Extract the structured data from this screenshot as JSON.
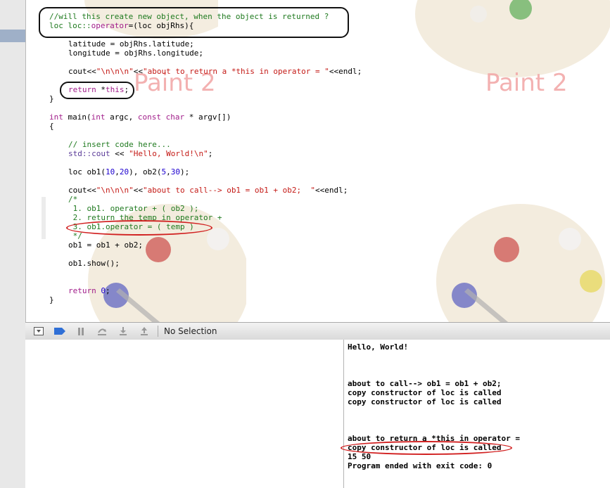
{
  "code": {
    "l1": "//will this create new object, when the object is returned ?",
    "l2_type": "loc",
    "l2_scope": "loc::",
    "l2_op": "operator",
    "l2_rest": "=(loc objRhs){",
    "l3": "latitude = objRhs.latitude;",
    "l4": "longitude = objRhs.longitude;",
    "l5_a": "cout<<",
    "l5_b": "\"\\n\\n\\n\"",
    "l5_c": "<<",
    "l5_d": "\"about to return a *this in operator = \"",
    "l5_e": "<<endl;",
    "l6_kw": "return",
    "l6_rest": " *",
    "l6_this": "this",
    "l6_end": ";",
    "l7": "}",
    "l8_int": "int",
    "l8_main": " main(",
    "l8_int2": "int",
    "l8_argc": " argc, ",
    "l8_const": "const",
    "l8_char": " char",
    "l8_rest": " * argv[])",
    "l9": "{",
    "l10": "// insert code here...",
    "l11_a": "std::cout",
    "l11_b": " << ",
    "l11_c": "\"Hello, World!\\n\"",
    "l11_d": ";",
    "l12_a": "loc ob1(",
    "l12_b": "10",
    "l12_c": ",",
    "l12_d": "20",
    "l12_e": "), ob2(",
    "l12_f": "5",
    "l12_g": ",",
    "l12_h": "30",
    "l12_i": ");",
    "l13_a": "cout<<",
    "l13_b": "\"\\n\\n\\n\"",
    "l13_c": "<<",
    "l13_d": "\"about to call--> ob1 = ob1 + ob2;  \"",
    "l13_e": "<<endl;",
    "l14": "/*",
    "l15": " 1. ob1. operator + ( ob2 );",
    "l16": " 2. return the temp in operator +",
    "l17": " 3. ob1.operator = ( temp )",
    "l18": " */",
    "l19": "ob1 = ob1 + ob2;",
    "l20": "ob1.show();",
    "l21_kw": "return",
    "l21_num": " 0",
    "l21_end": ";",
    "l22": "}"
  },
  "watermark": "Paint 2",
  "toolbar": {
    "selection_label": "No Selection"
  },
  "console": {
    "lines": [
      "Hello, World!",
      "about to call--> ob1 = ob1 + ob2;",
      "copy constructor of loc is called",
      "copy constructor of loc is called",
      "about to return a *this in operator =",
      "copy constructor of loc is called",
      "15 50",
      "Program ended with exit code: 0"
    ]
  },
  "colors": {
    "comment": "#1f7a1f",
    "keyword": "#a11d8a",
    "string": "#c41a16",
    "number": "#1c00cf",
    "annotation_red": "#d12020",
    "watermark": "#f2a9a9"
  }
}
